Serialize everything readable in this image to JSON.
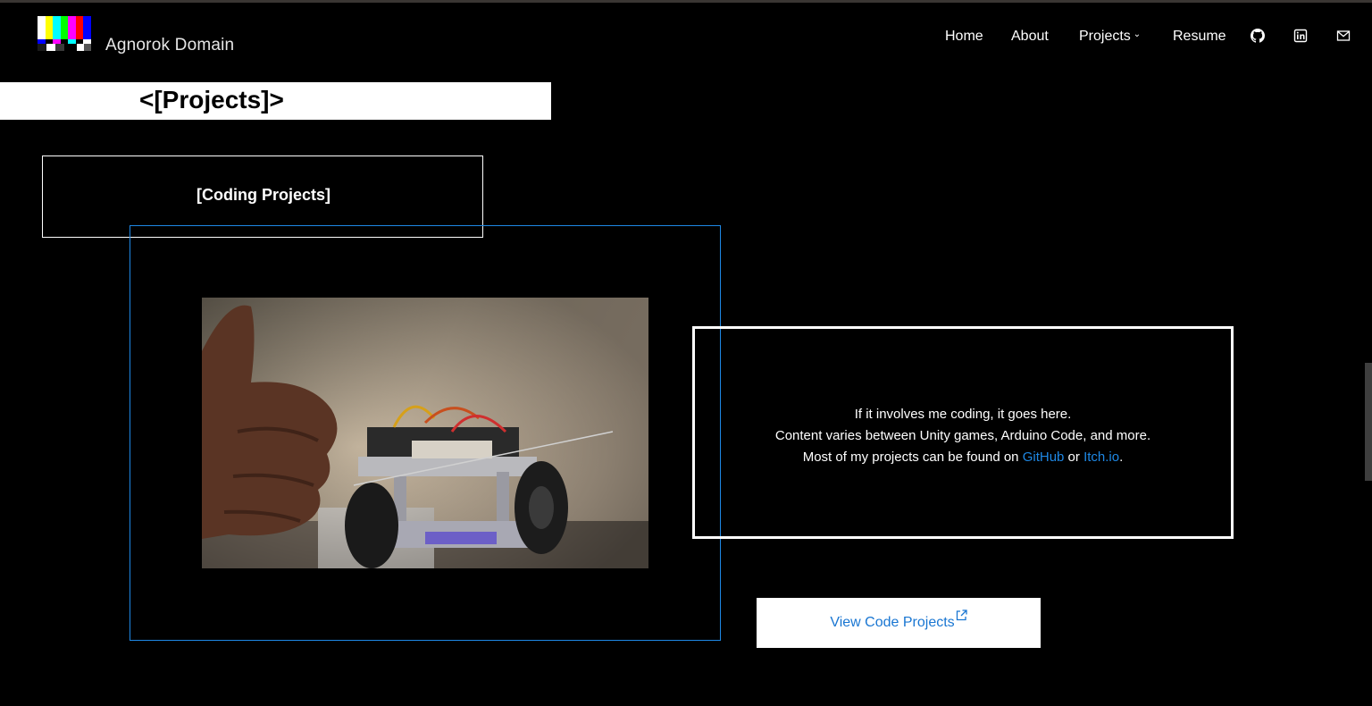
{
  "nav": {
    "brand_name": "Agnorok Domain",
    "items": [
      {
        "label": "Home"
      },
      {
        "label": "About"
      },
      {
        "label": "Projects"
      },
      {
        "label": "Resume"
      }
    ],
    "icons": [
      "github-icon",
      "linkedin-icon",
      "mail-icon"
    ]
  },
  "page": {
    "title": "<[Projects]>"
  },
  "section": {
    "title": "[Coding Projects]",
    "description": {
      "line1": "If it involves me coding, it goes here.",
      "line2": "Content varies between Unity games, Arduino Code, and more.",
      "line3_prefix": "Most of my projects can be found on ",
      "github_link": "GitHub",
      "or_text": " or ",
      "itch_link": "Itch.io",
      "line3_suffix": "."
    },
    "button_label": "View Code Projects"
  },
  "colors": {
    "background": "#000000",
    "link": "#1e88e5",
    "frame_border": "#1e88e5",
    "button_text": "#1976d2"
  }
}
